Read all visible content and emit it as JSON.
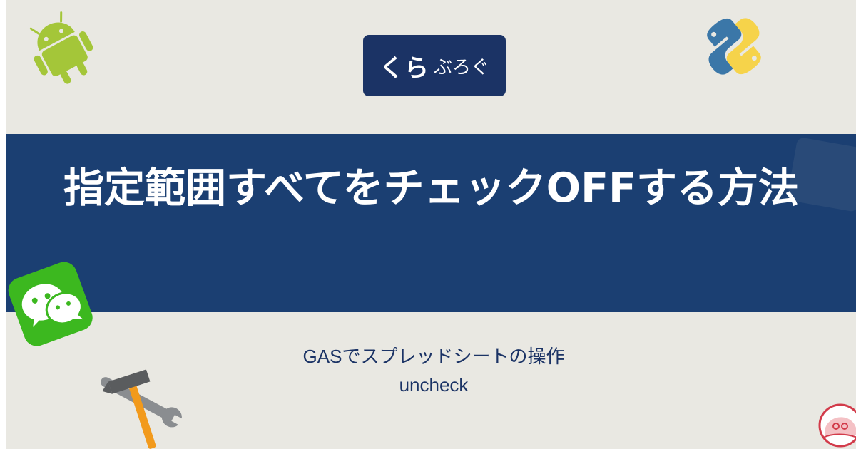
{
  "logo": {
    "main": "くら",
    "sub": "ぶろぐ"
  },
  "title": "指定範囲すべてをチェックOFFする方法",
  "subtitle": {
    "line1": "GASでスプレッドシートの操作",
    "line2": "uncheck"
  },
  "colors": {
    "background": "#e9e8e2",
    "banner": "#1b3f72",
    "logo_bg": "#1b3365",
    "subtitle_text": "#1b3365",
    "android_green": "#a4c639",
    "python_blue": "#3b77a8",
    "python_yellow": "#f6d34a",
    "wechat_green": "#3cb81f",
    "hammer_orange": "#f29a1c"
  },
  "icons": [
    "android-icon",
    "python-icon",
    "wechat-icon",
    "tools-icon",
    "avatar-icon"
  ]
}
